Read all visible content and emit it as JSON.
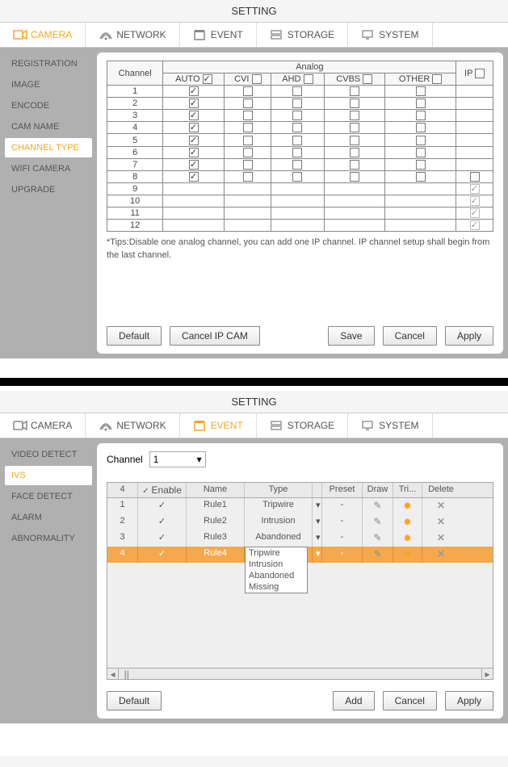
{
  "panel1": {
    "title": "SETTING",
    "tabs": [
      "CAMERA",
      "NETWORK",
      "EVENT",
      "STORAGE",
      "SYSTEM"
    ],
    "activeTab": 0,
    "sidebar": [
      "REGISTRATION",
      "IMAGE",
      "ENCODE",
      "CAM NAME",
      "CHANNEL TYPE",
      "WIFI CAMERA",
      "UPGRADE"
    ],
    "activeSide": 4,
    "table": {
      "groupHeader": "Analog",
      "cols": [
        "Channel",
        "AUTO",
        "CVI",
        "AHD",
        "CVBS",
        "OTHER",
        "IP"
      ],
      "headerChecks": {
        "AUTO": true,
        "CVI": false,
        "AHD": false,
        "CVBS": false,
        "OTHER": false,
        "IP": false
      },
      "rows": [
        {
          "ch": "1",
          "auto": true,
          "cvi": false,
          "ahd": false,
          "cvbs": false,
          "other": false,
          "ip": null
        },
        {
          "ch": "2",
          "auto": true,
          "cvi": false,
          "ahd": false,
          "cvbs": false,
          "other": false,
          "ip": null
        },
        {
          "ch": "3",
          "auto": true,
          "cvi": false,
          "ahd": false,
          "cvbs": false,
          "other": false,
          "ip": null
        },
        {
          "ch": "4",
          "auto": true,
          "cvi": false,
          "ahd": false,
          "cvbs": false,
          "other": false,
          "ip": null
        },
        {
          "ch": "5",
          "auto": true,
          "cvi": false,
          "ahd": false,
          "cvbs": false,
          "other": false,
          "ip": null
        },
        {
          "ch": "6",
          "auto": true,
          "cvi": false,
          "ahd": false,
          "cvbs": false,
          "other": false,
          "ip": null
        },
        {
          "ch": "7",
          "auto": true,
          "cvi": false,
          "ahd": false,
          "cvbs": false,
          "other": false,
          "ip": null
        },
        {
          "ch": "8",
          "auto": true,
          "cvi": false,
          "ahd": false,
          "cvbs": false,
          "other": false,
          "ip": false
        },
        {
          "ch": "9",
          "auto": null,
          "cvi": null,
          "ahd": null,
          "cvbs": null,
          "other": null,
          "ip": true,
          "light": true
        },
        {
          "ch": "10",
          "auto": null,
          "cvi": null,
          "ahd": null,
          "cvbs": null,
          "other": null,
          "ip": true,
          "light": true
        },
        {
          "ch": "11",
          "auto": null,
          "cvi": null,
          "ahd": null,
          "cvbs": null,
          "other": null,
          "ip": true,
          "light": true
        },
        {
          "ch": "12",
          "auto": null,
          "cvi": null,
          "ahd": null,
          "cvbs": null,
          "other": null,
          "ip": true,
          "light": true
        }
      ]
    },
    "tips": "*Tips:Disable one analog channel, you can add one IP channel. IP channel setup shall begin from the last channel.",
    "buttons": {
      "default": "Default",
      "cancelip": "Cancel IP CAM",
      "save": "Save",
      "cancel": "Cancel",
      "apply": "Apply"
    }
  },
  "panel2": {
    "title": "SETTING",
    "tabs": [
      "CAMERA",
      "NETWORK",
      "EVENT",
      "STORAGE",
      "SYSTEM"
    ],
    "activeTab": 2,
    "sidebar": [
      "VIDEO DETECT",
      "IVS",
      "FACE DETECT",
      "ALARM",
      "ABNORMALITY"
    ],
    "activeSide": 1,
    "channelLabel": "Channel",
    "channelValue": "1",
    "ruleHead": {
      "count": "4",
      "enable": "Enable",
      "name": "Name",
      "type": "Type",
      "preset": "Preset",
      "draw": "Draw",
      "tri": "Tri...",
      "delete": "Delete"
    },
    "rules": [
      {
        "n": "1",
        "en": true,
        "name": "Rule1",
        "type": "Tripwire",
        "preset": "-"
      },
      {
        "n": "2",
        "en": true,
        "name": "Rule2",
        "type": "Intrusion",
        "preset": "-"
      },
      {
        "n": "3",
        "en": true,
        "name": "Rule3",
        "type": "Abandoned",
        "preset": "-"
      },
      {
        "n": "4",
        "en": true,
        "name": "Rule4",
        "type": "Missing",
        "preset": "-",
        "sel": true
      }
    ],
    "dropdown": [
      "Tripwire",
      "Intrusion",
      "Abandoned",
      "Missing"
    ],
    "buttons": {
      "default": "Default",
      "add": "Add",
      "cancel": "Cancel",
      "apply": "Apply"
    }
  },
  "icons": {
    "camera": "cam",
    "network": "net",
    "event": "evt",
    "storage": "sto",
    "system": "sys"
  }
}
